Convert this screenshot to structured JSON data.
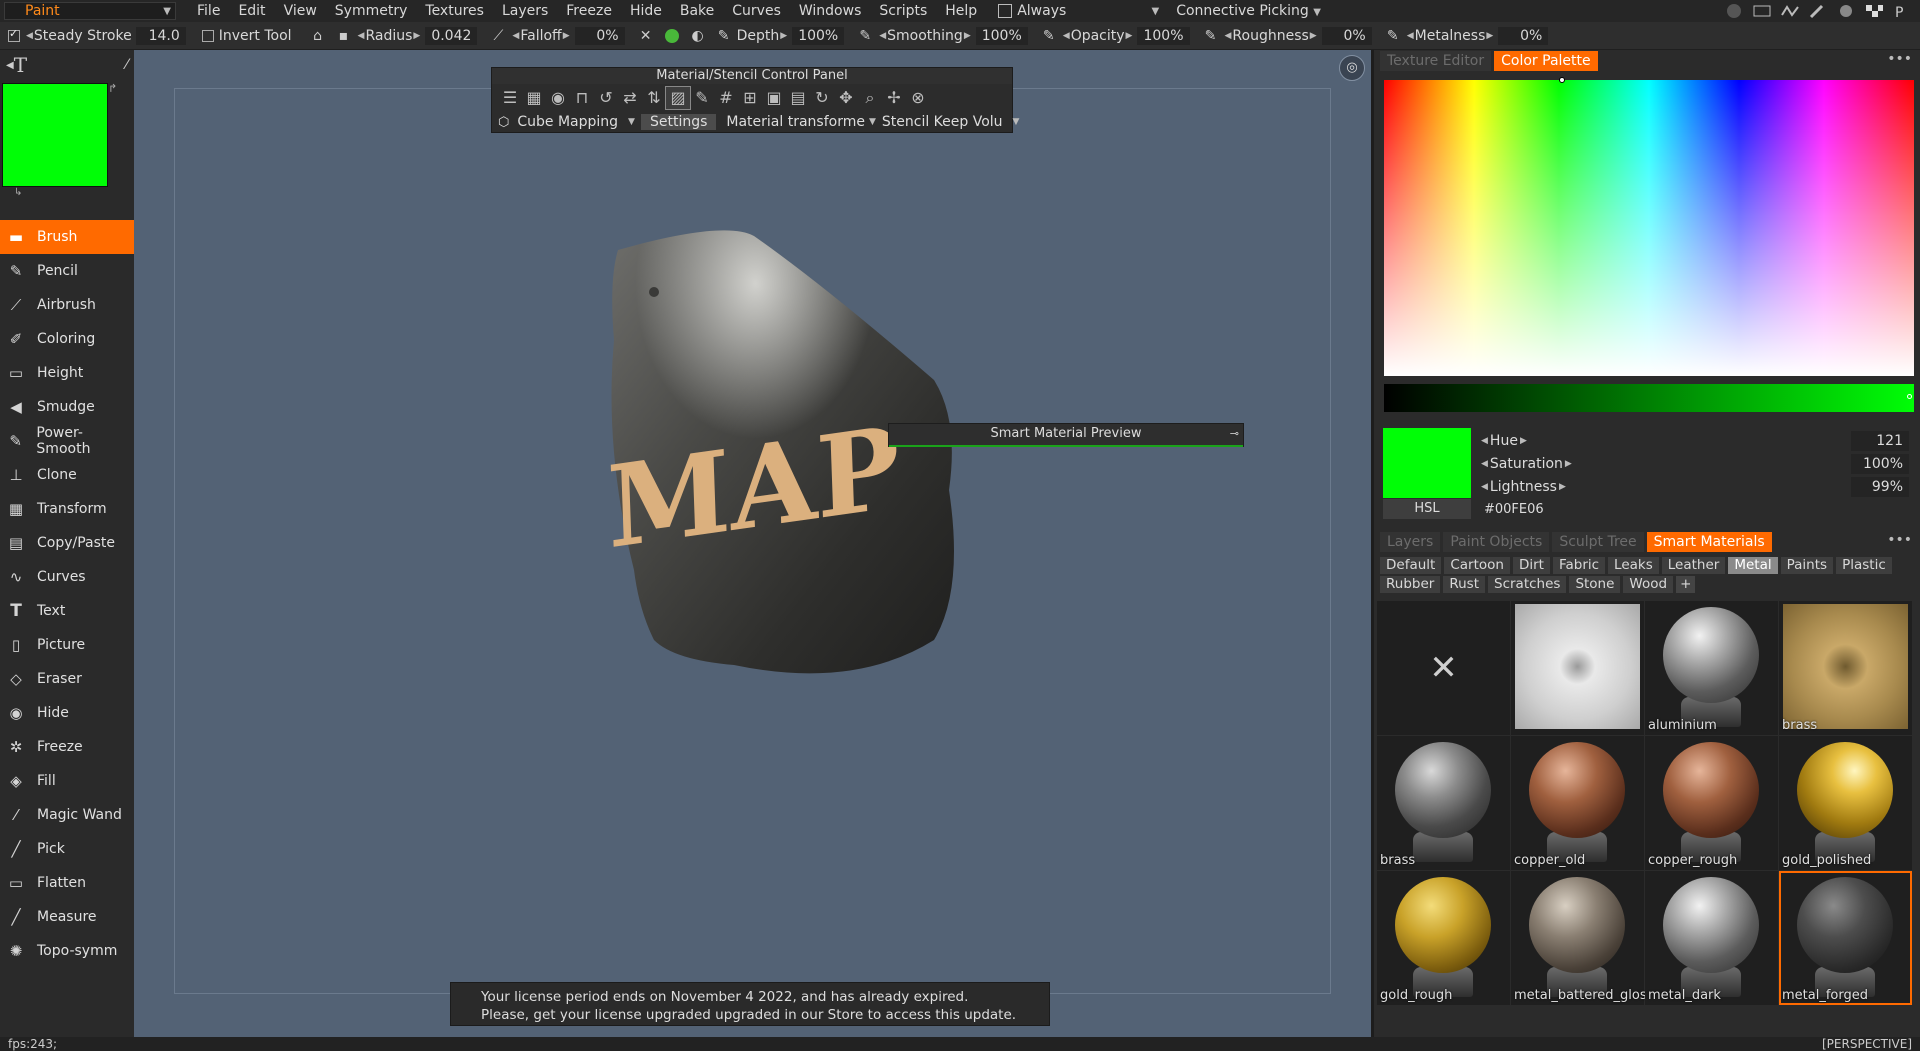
{
  "menubar": {
    "room": "Paint",
    "items": [
      "File",
      "Edit",
      "View",
      "Symmetry",
      "Textures",
      "Layers",
      "Freeze",
      "Hide",
      "Bake",
      "Curves",
      "Windows",
      "Scripts",
      "Help"
    ],
    "always_label": "Always",
    "picking_label": "Connective Picking"
  },
  "toolbar": {
    "steady_stroke_label": "Steady Stroke",
    "steady_stroke_value": "14.0",
    "invert_tool_label": "Invert Tool",
    "radius_label": "Radius",
    "radius_value": "0.042",
    "falloff_label": "Falloff",
    "falloff_value": "0%",
    "depth_label": "Depth",
    "depth_value": "100%",
    "smoothing_label": "Smoothing",
    "smoothing_value": "100%",
    "opacity_label": "Opacity",
    "opacity_value": "100%",
    "roughness_label": "Roughness",
    "roughness_value": "0%",
    "metalness_label": "Metalness",
    "metalness_value": "0%"
  },
  "tools": [
    {
      "label": "Brush",
      "icon": "brush-icon",
      "glyph": "▬",
      "active": true
    },
    {
      "label": "Pencil",
      "icon": "pencil-icon",
      "glyph": "✎"
    },
    {
      "label": "Airbrush",
      "icon": "airbrush-icon",
      "glyph": "⟋"
    },
    {
      "label": "Coloring",
      "icon": "coloring-icon",
      "glyph": "✐"
    },
    {
      "label": "Height",
      "icon": "height-icon",
      "glyph": "▭"
    },
    {
      "label": "Smudge",
      "icon": "smudge-icon",
      "glyph": "◀"
    },
    {
      "label": "Power-Smooth",
      "icon": "power-smooth-icon",
      "glyph": "✎"
    },
    {
      "label": "Clone",
      "icon": "clone-icon",
      "glyph": "⊥"
    },
    {
      "label": "Transform",
      "icon": "transform-icon",
      "glyph": "▦"
    },
    {
      "label": "Copy/Paste",
      "icon": "copy-paste-icon",
      "glyph": "▤"
    },
    {
      "label": "Curves",
      "icon": "curves-icon",
      "glyph": "∿"
    },
    {
      "label": "Text",
      "icon": "text-icon",
      "glyph": "T"
    },
    {
      "label": "Picture",
      "icon": "picture-icon",
      "glyph": "▯"
    },
    {
      "label": "Eraser",
      "icon": "eraser-icon",
      "glyph": "◇"
    },
    {
      "label": "Hide",
      "icon": "hide-icon",
      "glyph": "◉"
    },
    {
      "label": "Freeze",
      "icon": "freeze-icon",
      "glyph": "✲"
    },
    {
      "label": "Fill",
      "icon": "fill-icon",
      "glyph": "◈"
    },
    {
      "label": "Magic Wand",
      "icon": "magic-wand-icon",
      "glyph": "⁄"
    },
    {
      "label": "Pick",
      "icon": "pick-icon",
      "glyph": "╱"
    },
    {
      "label": "Flatten",
      "icon": "flatten-icon",
      "glyph": "▭"
    },
    {
      "label": "Measure",
      "icon": "measure-icon",
      "glyph": "╱"
    },
    {
      "label": "Topo-symm",
      "icon": "topo-symm-icon",
      "glyph": "✺"
    }
  ],
  "colors": {
    "primary": "#00fe06",
    "accent": "#ff6a00",
    "viewport_bg": "#536275"
  },
  "material_panel": {
    "title": "Material/Stencil Control Panel",
    "mapping": "Cube Mapping",
    "settings": "Settings",
    "transform": "Material transforme",
    "stencil": "Stencil Keep Volu"
  },
  "viewport": {
    "mesh_text": "MAP",
    "preview_title": "Smart Material Preview",
    "license_line1": "Your license period ends on November 4 2022, and has already expired.",
    "license_line2": "Please, get your license upgraded upgraded in our Store to access this update."
  },
  "status": {
    "fps": "fps:243;",
    "view_mode": "[PERSPECTIVE]"
  },
  "color_panel": {
    "tabs": [
      "Texture Editor",
      "Color Palette"
    ],
    "active_tab": 1,
    "hue_label": "Hue",
    "hue_value": "121",
    "saturation_label": "Saturation",
    "saturation_value": "100%",
    "lightness_label": "Lightness",
    "lightness_value": "99%",
    "mode": "HSL",
    "hex": "#00FE06"
  },
  "materials_panel": {
    "tabs": [
      "Layers",
      "Paint Objects",
      "Sculpt Tree",
      "Smart Materials"
    ],
    "active_tab": 3,
    "categories_row1": [
      "Default",
      "Cartoon",
      "Dirt",
      "Fabric",
      "Leaks",
      "Leather",
      "Metal",
      "Paints",
      "Plastic"
    ],
    "categories_row2": [
      "Rubber",
      "Rust",
      "Scratches",
      "Stone",
      "Wood"
    ],
    "add_label": "+",
    "active_category": "Metal",
    "items": [
      {
        "label": "",
        "kind": "none"
      },
      {
        "label": "",
        "kind": "square",
        "tone": "silver"
      },
      {
        "label": "aluminium",
        "kind": "sphere",
        "tone": "steel"
      },
      {
        "label": "brass",
        "kind": "square",
        "tone": "brass"
      },
      {
        "label": "brass",
        "kind": "sphere",
        "tone": "dark-steel"
      },
      {
        "label": "copper_old",
        "kind": "sphere",
        "tone": "copper"
      },
      {
        "label": "copper_rough",
        "kind": "sphere",
        "tone": "copper"
      },
      {
        "label": "gold_polished",
        "kind": "sphere",
        "tone": "gold"
      },
      {
        "label": "gold_rough",
        "kind": "sphere",
        "tone": "gold-rough"
      },
      {
        "label": "metal_battered_gloss",
        "kind": "sphere",
        "tone": "battered"
      },
      {
        "label": "metal_dark",
        "kind": "sphere",
        "tone": "steel"
      },
      {
        "label": "metal_forged",
        "kind": "sphere",
        "tone": "forged",
        "selected": true
      }
    ]
  }
}
